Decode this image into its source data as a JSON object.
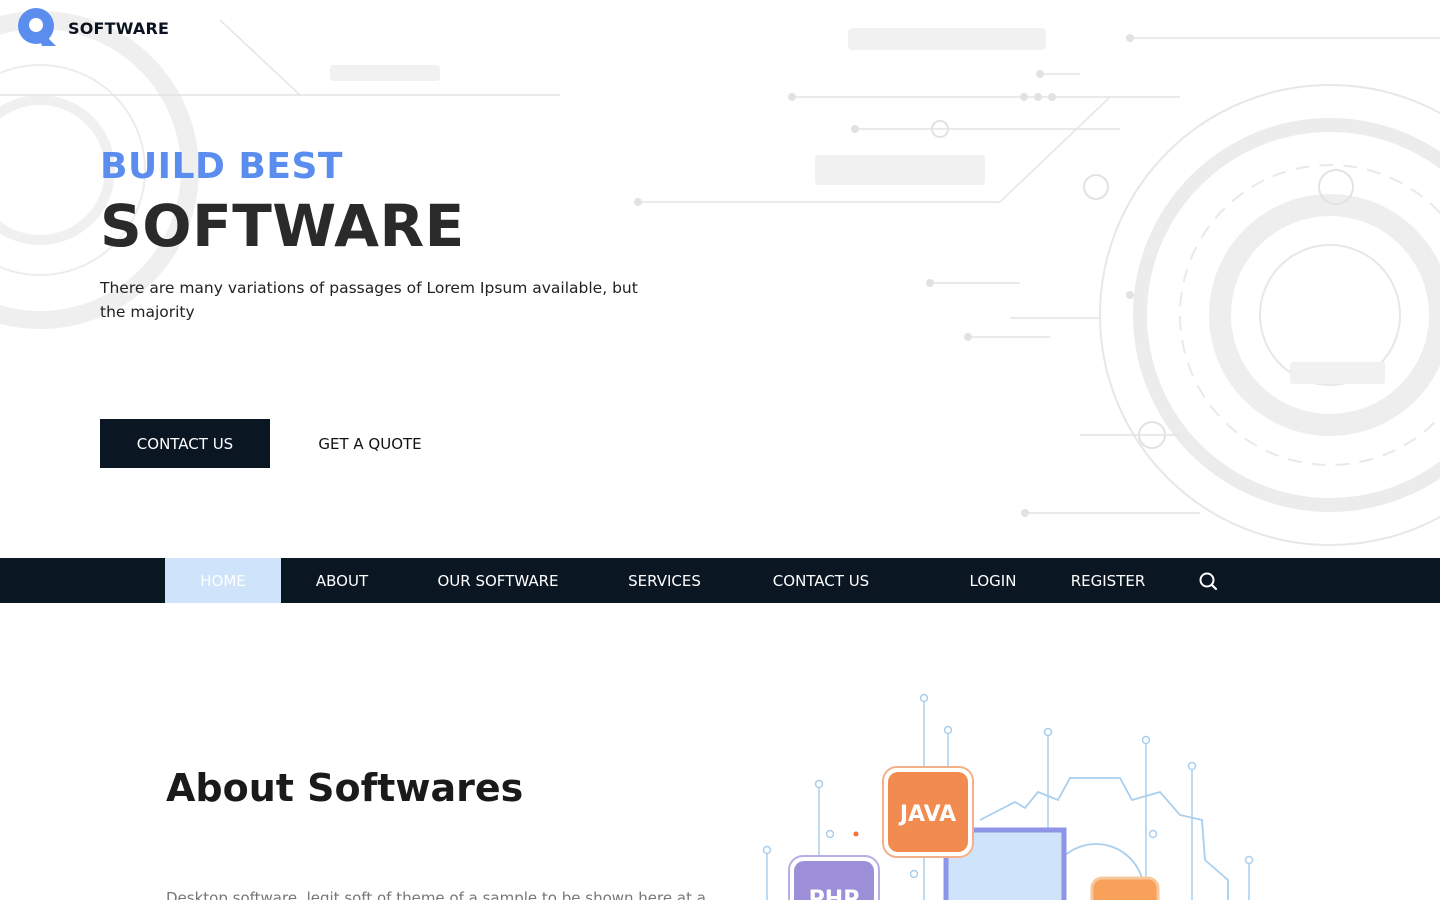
{
  "brand": {
    "name": "SOFTWARE",
    "logo_letter": "Q"
  },
  "hero": {
    "subtitle": "BUILD BEST",
    "title": "SOFTWARE",
    "description": "There are many variations of passages of Lorem Ipsum available, but the majority",
    "primary_cta": "CONTACT US",
    "secondary_cta": "GET A QUOTE"
  },
  "nav": {
    "items": [
      {
        "label": "HOME",
        "active": true
      },
      {
        "label": "ABOUT"
      },
      {
        "label": "OUR SOFTWARE"
      },
      {
        "label": "SERVICES"
      },
      {
        "label": "CONTACT US"
      },
      {
        "label": "LOGIN"
      },
      {
        "label": "REGISTER"
      }
    ],
    "search_icon": "search-icon"
  },
  "about": {
    "title": "About Softwares",
    "text_partial": "Desktop software, legit soft of theme of a sample to be shown here at a time"
  },
  "illustration": {
    "badges": [
      "JAVA",
      "PHP"
    ]
  },
  "colors": {
    "accent": "#5b8def",
    "dark": "#0b1623",
    "nav_active": "#cfe3fb",
    "java_badge": "#f28b50",
    "php_badge": "#9c8fd8"
  }
}
